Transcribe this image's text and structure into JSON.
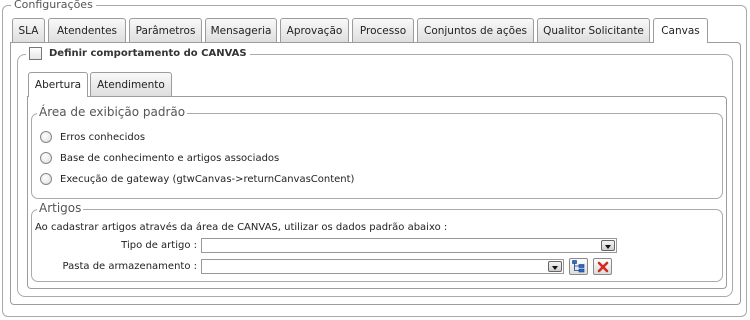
{
  "window": {
    "legend": "Configurações"
  },
  "tabs": [
    {
      "label": "SLA"
    },
    {
      "label": "Atendentes"
    },
    {
      "label": "Parâmetros"
    },
    {
      "label": "Mensageria"
    },
    {
      "label": "Aprovação"
    },
    {
      "label": "Processo"
    },
    {
      "label": "Conjuntos de ações"
    },
    {
      "label": "Qualitor Solicitante"
    },
    {
      "label": "Canvas",
      "active": true
    }
  ],
  "canvas": {
    "define_label": "Definir comportamento do CANVAS",
    "define_checked": false,
    "subtabs": [
      {
        "label": "Abertura",
        "active": true
      },
      {
        "label": "Atendimento"
      }
    ],
    "display_area": {
      "legend": "Área de exibição padrão",
      "options": [
        {
          "label": "Erros conhecidos",
          "selected": false
        },
        {
          "label": "Base de conhecimento e artigos associados",
          "selected": false
        },
        {
          "label": "Execução de gateway (gtwCanvas->returnCanvasContent)",
          "selected": false
        }
      ]
    },
    "articles": {
      "legend": "Artigos",
      "instruction": "Ao cadastrar artigos através da área de CANVAS, utilizar os dados padrão abaixo :",
      "article_type_label": "Tipo de artigo :",
      "article_type_value": "",
      "storage_folder_label": "Pasta de armazenamento :",
      "storage_folder_value": ""
    }
  },
  "icons": {
    "tree": "folder-tree-icon",
    "clear": "clear-icon",
    "dropdown": "chevron-down-icon",
    "accent_blue": "#1f5fbf",
    "accent_red": "#d22b1f"
  }
}
